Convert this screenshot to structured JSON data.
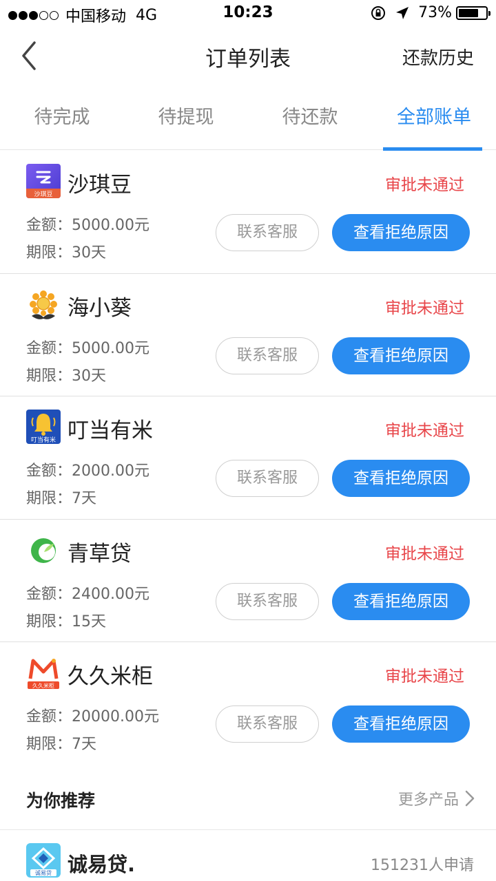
{
  "status_bar": {
    "carrier": "中国移动",
    "network": "4G",
    "time": "10:23",
    "battery": "73%",
    "battery_level": 0.73,
    "signal_bars_filled": 3,
    "signal_bars_total": 5
  },
  "nav": {
    "title": "订单列表",
    "right_label": "还款历史",
    "back_icon": "chevron-left-icon"
  },
  "tabs": [
    {
      "label": "待完成",
      "active": false
    },
    {
      "label": "待提现",
      "active": false
    },
    {
      "label": "待还款",
      "active": false
    },
    {
      "label": "全部账单",
      "active": true
    }
  ],
  "colors": {
    "accent": "#2a8cf0",
    "status_rejected": "#e8464a",
    "muted": "#888888"
  },
  "orders": [
    {
      "name": "沙琪豆",
      "status": "审批未通过",
      "amount": "金额：5000.00元",
      "term": "期限：30天",
      "contact_label": "联系客服",
      "reason_label": "查看拒绝原因",
      "logo": "shaqidou-logo-icon",
      "logo_text": "沙琪豆"
    },
    {
      "name": "海小葵",
      "status": "审批未通过",
      "amount": "金额：5000.00元",
      "term": "期限：30天",
      "contact_label": "联系客服",
      "reason_label": "查看拒绝原因",
      "logo": "sunflower-logo-icon"
    },
    {
      "name": "叮当有米",
      "status": "审批未通过",
      "amount": "金额：2000.00元",
      "term": "期限：7天",
      "contact_label": "联系客服",
      "reason_label": "查看拒绝原因",
      "logo": "bell-logo-icon",
      "logo_text": "叮当有米"
    },
    {
      "name": "青草贷",
      "status": "审批未通过",
      "amount": "金额：2400.00元",
      "term": "期限：15天",
      "contact_label": "联系客服",
      "reason_label": "查看拒绝原因",
      "logo": "green-leaf-logo-icon"
    },
    {
      "name": "久久米柜",
      "status": "审批未通过",
      "amount": "金额：20000.00元",
      "term": "期限：7天",
      "contact_label": "联系客服",
      "reason_label": "查看拒绝原因",
      "logo": "m-letter-logo-icon",
      "logo_text": "久久米柜"
    }
  ],
  "recommend": {
    "title": "为你推荐",
    "more_label": "更多产品",
    "items": [
      {
        "name": "诚易贷.",
        "count": "151231人申请",
        "logo": "chengyidai-logo-icon",
        "logo_text": "诚易贷"
      }
    ]
  }
}
